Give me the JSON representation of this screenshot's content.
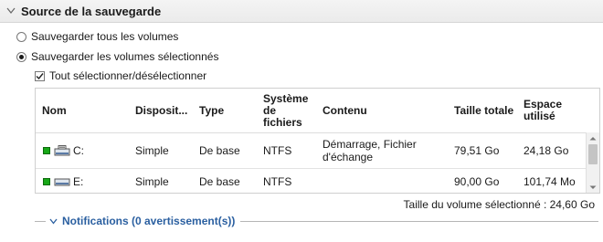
{
  "section": {
    "title": "Source de la sauvegarde",
    "collapse_icon": "chevron-down-icon"
  },
  "backup_options": [
    {
      "label": "Sauvegarder tous les volumes",
      "selected": false
    },
    {
      "label": "Sauvegarder les volumes sélectionnés",
      "selected": true
    }
  ],
  "select_all": {
    "label": "Tout sélectionner/désélectionner",
    "checked": true
  },
  "table": {
    "columns": [
      "Nom",
      "Disposit...",
      "Type",
      "Système de fichiers",
      "Contenu",
      "Taille totale",
      "Espace utilisé"
    ],
    "rows": [
      {
        "checked": true,
        "drive_icon": "system-drive-icon",
        "name": "C:",
        "layout": "Simple",
        "type": "De base",
        "fs": "NTFS",
        "content": "Démarrage, Fichier d'échange",
        "total": "79,51 Go",
        "used": "24,18 Go"
      },
      {
        "checked": true,
        "drive_icon": "hard-drive-icon",
        "name": "E:",
        "layout": "Simple",
        "type": "De base",
        "fs": "NTFS",
        "content": "",
        "total": "90,00 Go",
        "used": "101,74 Mo"
      }
    ]
  },
  "summary": "Taille du volume sélectionné : 24,60 Go",
  "notifications": {
    "label": "Notifications (0 avertissement(s))"
  },
  "colors": {
    "link": "#2a5fa0",
    "check_green": "#18a818"
  }
}
